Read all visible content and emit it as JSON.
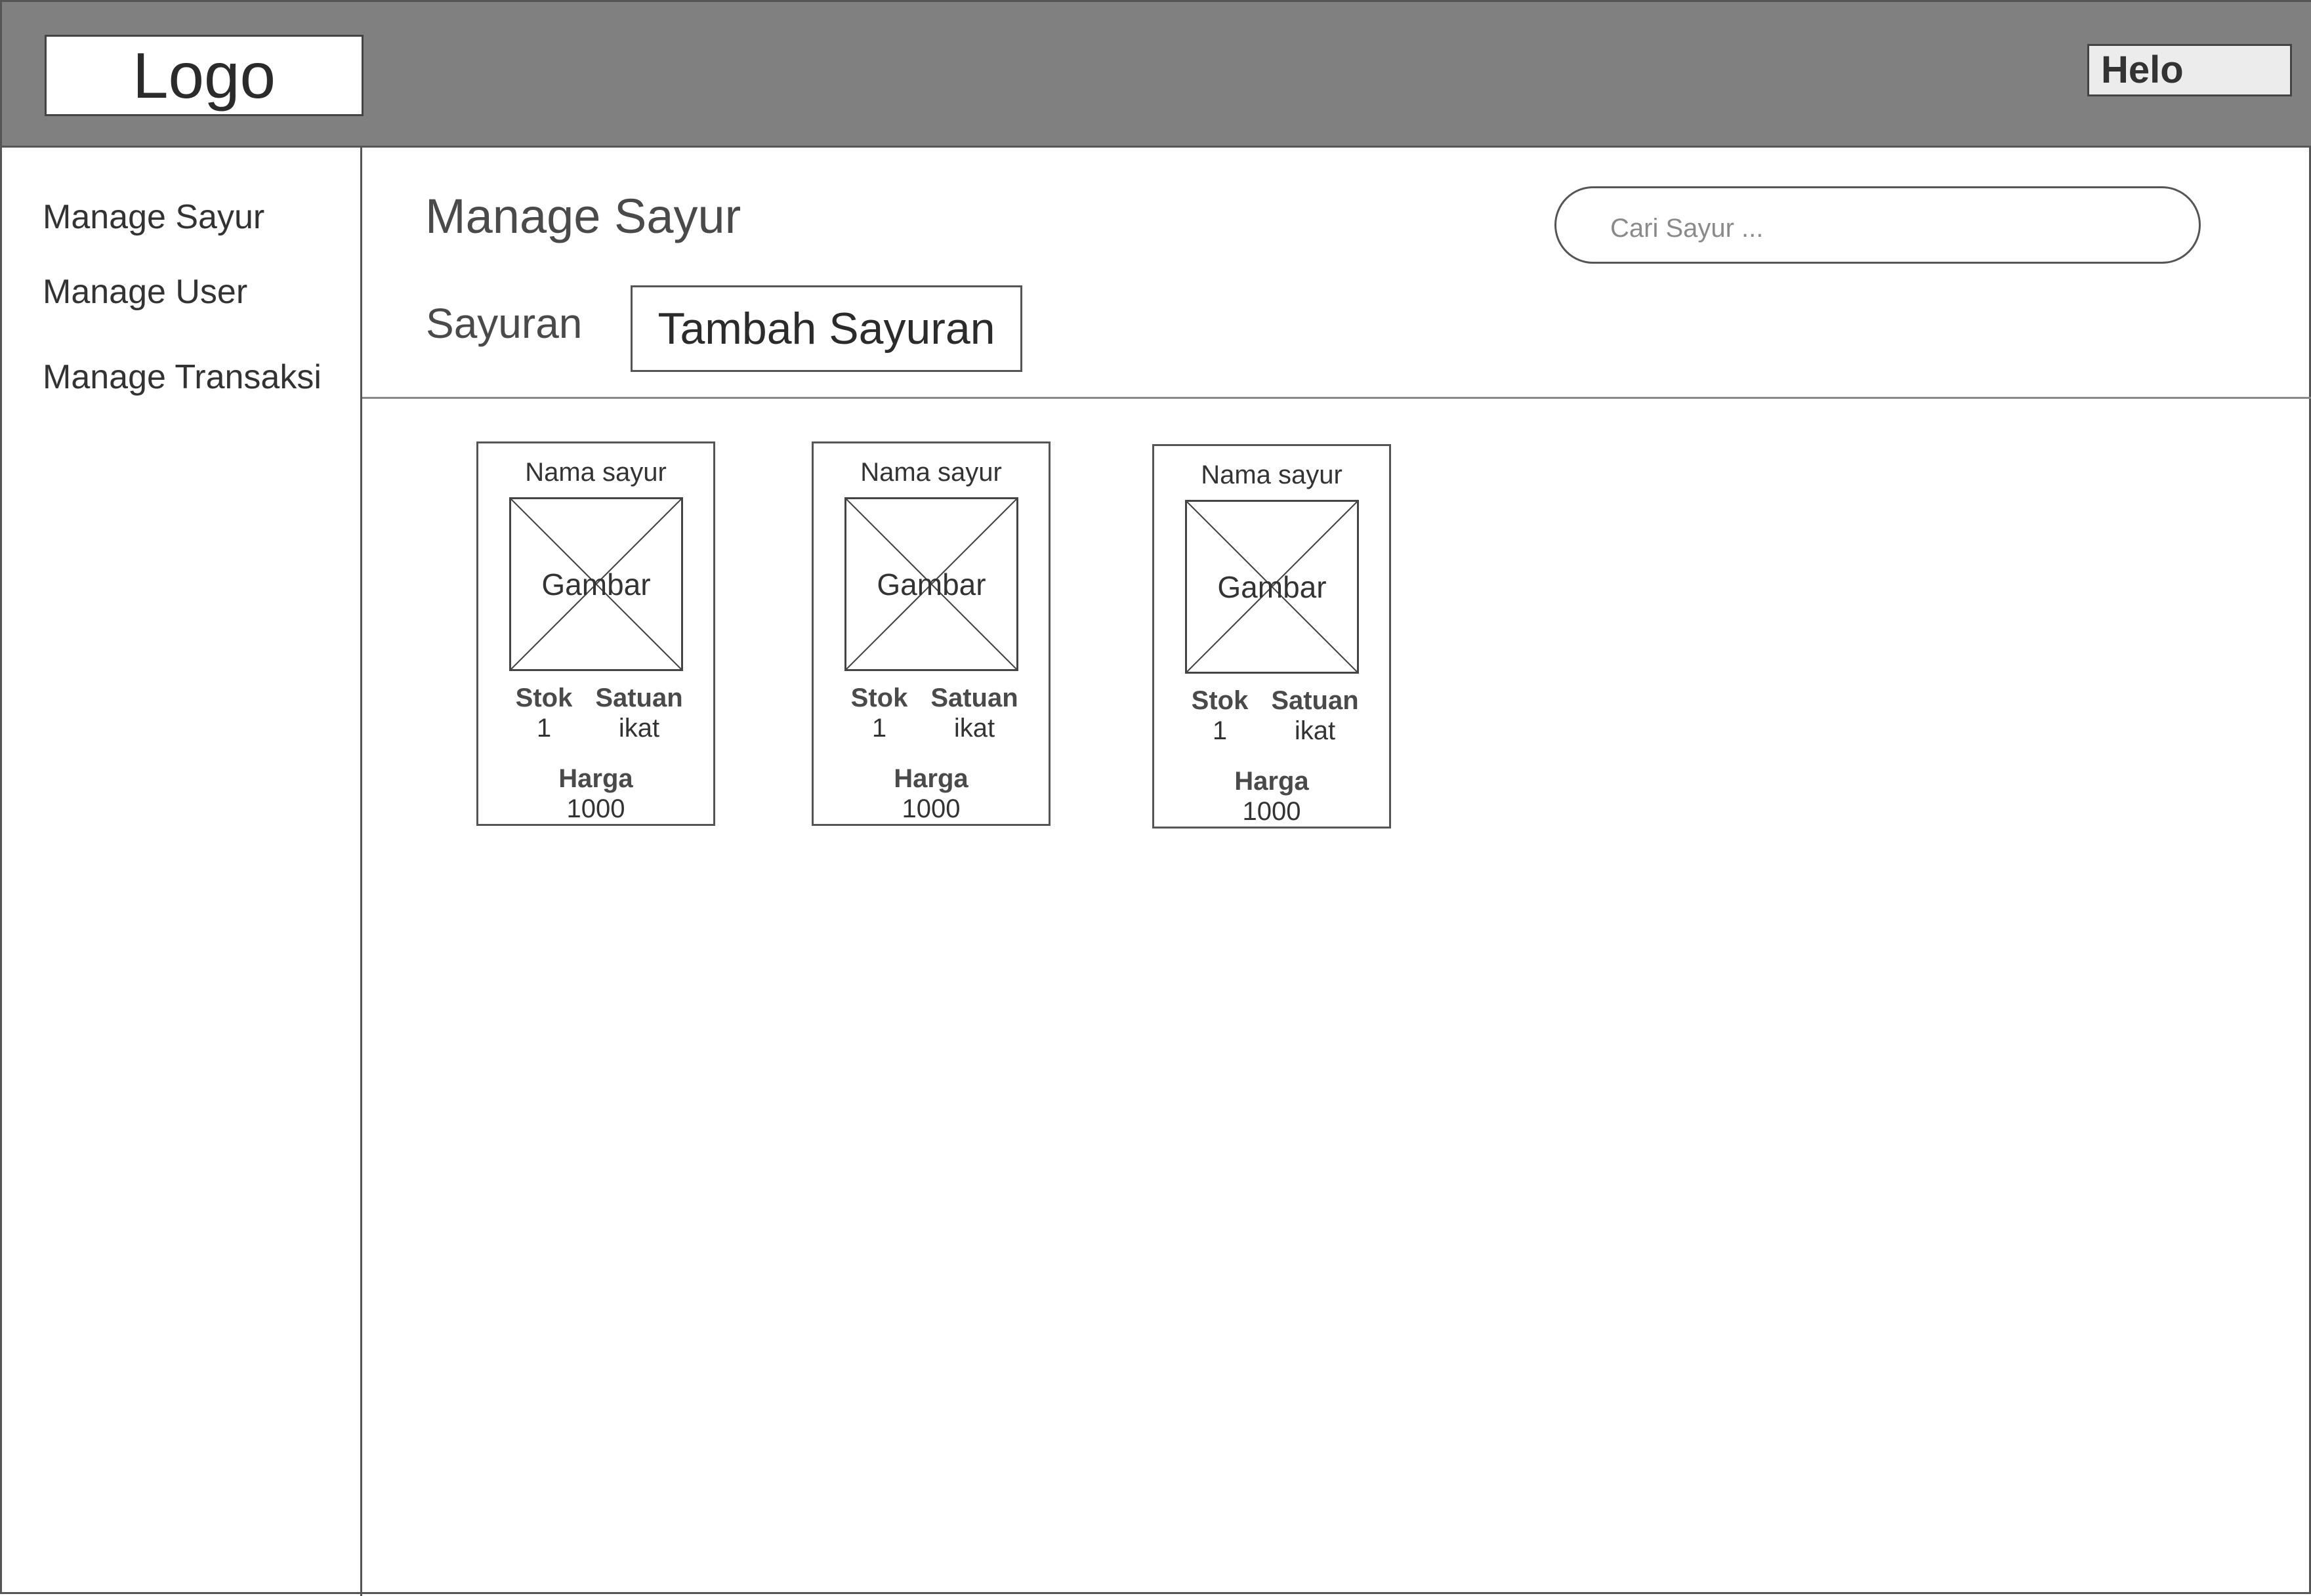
{
  "header": {
    "logo": "Logo",
    "user_button": "Helo"
  },
  "sidebar": {
    "items": [
      {
        "label": "Manage Sayur"
      },
      {
        "label": "Manage User"
      },
      {
        "label": "Manage Transaksi"
      }
    ]
  },
  "main": {
    "title": "Manage Sayur",
    "search_placeholder": "Cari Sayur ...",
    "tab_label": "Sayuran",
    "add_button": "Tambah Sayuran",
    "cards": [
      {
        "name": "Nama sayur",
        "image_label": "Gambar",
        "stok_label": "Stok",
        "stok_value": "1",
        "satuan_label": "Satuan",
        "satuan_value": "ikat",
        "harga_label": "Harga",
        "harga_value": "1000"
      },
      {
        "name": "Nama sayur",
        "image_label": "Gambar",
        "stok_label": "Stok",
        "stok_value": "1",
        "satuan_label": "Satuan",
        "satuan_value": "ikat",
        "harga_label": "Harga",
        "harga_value": "1000"
      },
      {
        "name": "Nama sayur",
        "image_label": "Gambar",
        "stok_label": "Stok",
        "stok_value": "1",
        "satuan_label": "Satuan",
        "satuan_value": "ikat",
        "harga_label": "Harga",
        "harga_value": "1000"
      }
    ]
  }
}
